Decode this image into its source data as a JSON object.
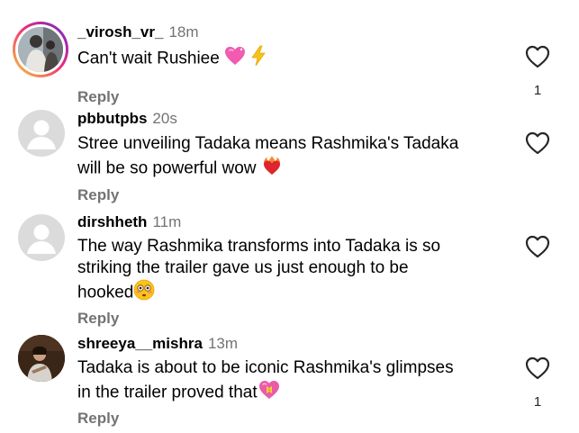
{
  "comments": [
    {
      "username": "_virosh_vr_",
      "time": "18m",
      "text": "Can't wait Rushiee",
      "reply_label": "Reply",
      "like_count": "1",
      "avatar": "story-ring-photo"
    },
    {
      "username": "pbbutpbs",
      "time": "20s",
      "text_line1": "Stree unveiling Tadaka means Rashmika's Tadaka",
      "text_line2": "will be so powerful wow",
      "reply_label": "Reply",
      "like_count": "",
      "avatar": "default-avatar"
    },
    {
      "username": "dirshheth",
      "time": "11m",
      "text_line1": "The way Rashmika transforms into Tadaka is so",
      "text_line2": "striking the trailer gave us just enough to be",
      "text_line3": "hooked",
      "reply_label": "Reply",
      "like_count": "",
      "avatar": "default-avatar"
    },
    {
      "username": "shreeya__mishra",
      "time": "13m",
      "text_line1": "Tadaka is about to be iconic Rashmika's glimpses",
      "text_line2": "in the trailer proved that",
      "reply_label": "Reply",
      "like_count": "1",
      "avatar": "photo-avatar"
    }
  ],
  "icons": {
    "like": "heart-outline-icon",
    "emoji_1": "sparkling-heart-emoji",
    "emoji_2": "high-voltage-emoji",
    "emoji_3": "heart-on-fire-emoji",
    "emoji_4": "flushed-face-emoji",
    "emoji_5": "heart-with-ribbon-emoji"
  },
  "colors": {
    "secondary_text": "#737373",
    "avatar_placeholder": "#dbdbdb",
    "story_ring_start": "#f9ce34",
    "story_ring_end": "#6228d7"
  }
}
